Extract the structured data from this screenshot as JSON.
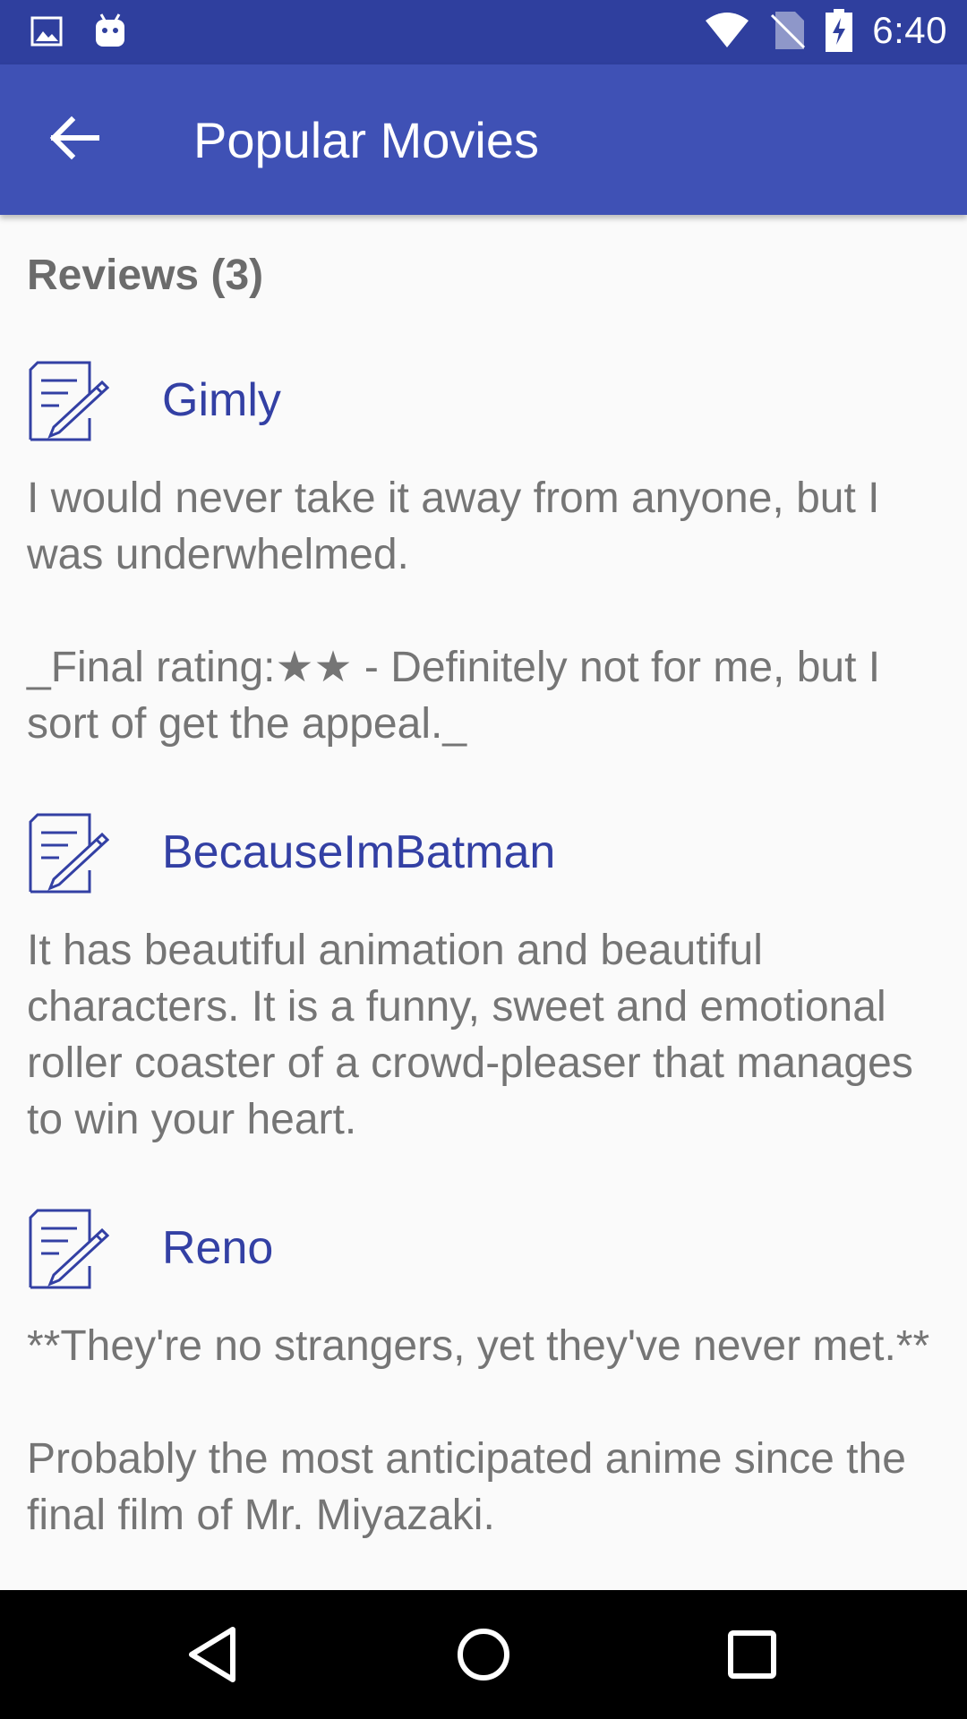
{
  "status_bar": {
    "time": "6:40",
    "icons": [
      "image-icon",
      "android-icon",
      "wifi-icon",
      "no-sim-icon",
      "battery-charging-icon"
    ]
  },
  "app_bar": {
    "title": "Popular Movies",
    "back_icon": "arrow-left-icon",
    "background": "#3f51b5"
  },
  "reviews": {
    "header": "Reviews (3)",
    "items": [
      {
        "author": "Gimly",
        "text": "I would never take it away from anyone, but I was underwhelmed.\n\n_Final rating:★★ - Definitely not for me, but I sort of get the appeal._"
      },
      {
        "author": "BecauseImBatman",
        "text": "It has beautiful animation and beautiful characters. It is a funny, sweet and emotional roller coaster of a crowd-pleaser that manages to win your heart."
      },
      {
        "author": "Reno",
        "text": "**They're no strangers, yet they've never met.**\n\nProbably the most anticipated anime since the final film of Mr. Miyazaki."
      }
    ],
    "author_color": "#3340a4",
    "text_color": "#757575"
  },
  "nav_bar": {
    "buttons": [
      "back-triangle-icon",
      "home-circle-icon",
      "recents-square-icon"
    ]
  }
}
